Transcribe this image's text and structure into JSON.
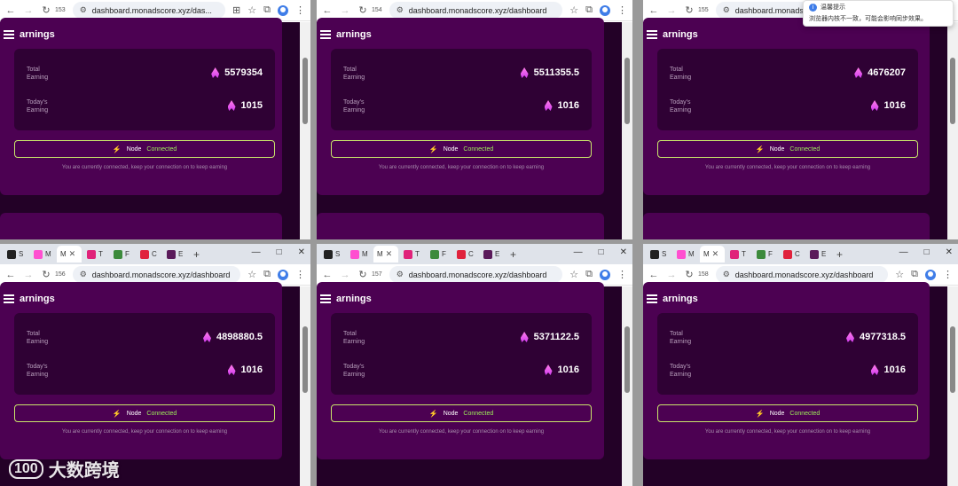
{
  "tabs": [
    {
      "label": "S",
      "color": "#222222"
    },
    {
      "label": "M",
      "color": "#ff4fd0"
    },
    {
      "label": "T",
      "color": "#e0227a"
    },
    {
      "label": "F",
      "color": "#3c8a3c"
    },
    {
      "label": "C",
      "color": "#e0223c"
    },
    {
      "label": "E",
      "color": "#5a1a5a"
    }
  ],
  "plus_label": "+",
  "window_controls": {
    "minimize": "—",
    "maximize": "□",
    "close": "✕"
  },
  "dashboard": {
    "header_title": "arnings",
    "total_label_1": "Total",
    "total_label_2": "Earning",
    "today_label_1": "Today's",
    "today_label_2": "Earning",
    "node_text": "Node",
    "connected_text": "Connected",
    "hint_text": "You are currently connected, keep your connection on to keep earning"
  },
  "windows": [
    {
      "tab_number": "153",
      "url": "dashboard.monadscore.xyz/das...",
      "total": "5579354",
      "today": "1015"
    },
    {
      "tab_number": "154",
      "url": "dashboard.monadscore.xyz/dashboard",
      "total": "5511355.5",
      "today": "1016"
    },
    {
      "tab_number": "155",
      "url": "dashboard.monadscore.xyz/dashboard",
      "total": "4676207",
      "today": "1016"
    },
    {
      "tab_number": "156",
      "url": "dashboard.monadscore.xyz/dashboard",
      "total": "4898880.5",
      "today": "1016"
    },
    {
      "tab_number": "157",
      "url": "dashboard.monadscore.xyz/dashboard",
      "total": "5371122.5",
      "today": "1016"
    },
    {
      "tab_number": "158",
      "url": "dashboard.monadscore.xyz/dashboard",
      "total": "4977318.5",
      "today": "1016"
    }
  ],
  "notification": {
    "title": "温馨提示",
    "body": "浏览器内核不一致，可能会影响同步效果。"
  },
  "watermark": {
    "mark": "100",
    "text": "大数跨境"
  },
  "colors": {
    "page_bg": "#230127",
    "card": "#4c0152",
    "inner": "#2f0134",
    "connected": "#9ef05a",
    "border": "#c9e56b"
  }
}
